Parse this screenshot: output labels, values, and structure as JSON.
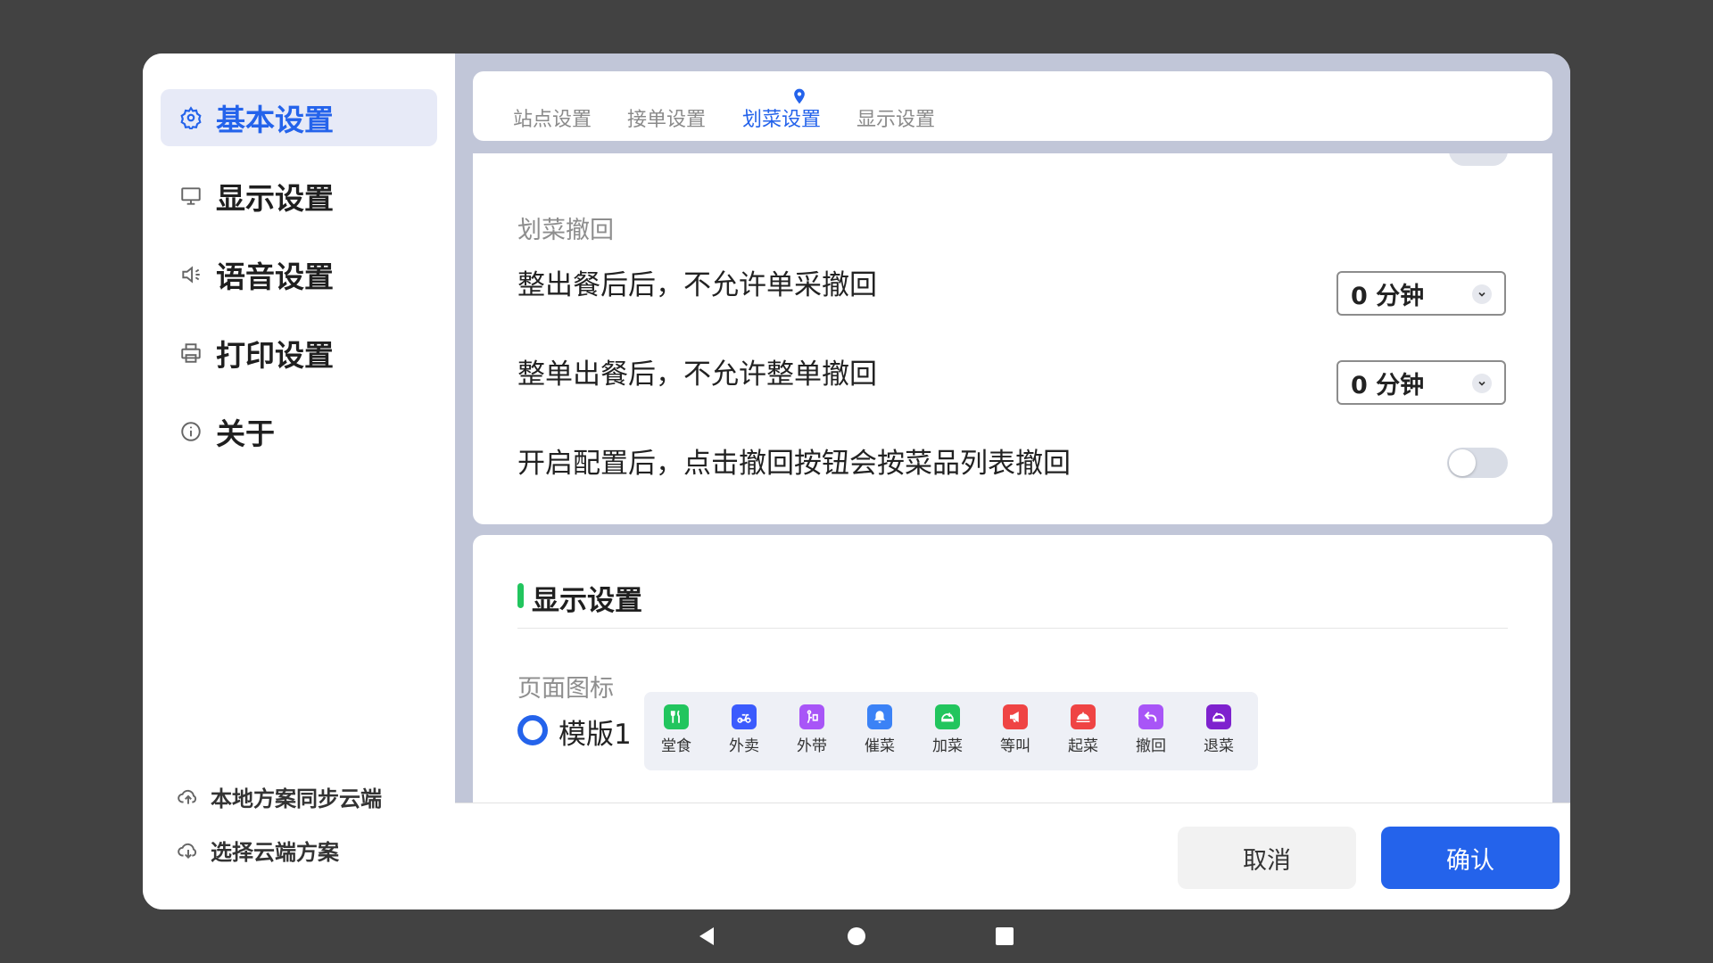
{
  "sidebar": {
    "items": [
      {
        "label": "基本设置",
        "icon": "gear-icon",
        "active": true
      },
      {
        "label": "显示设置",
        "icon": "monitor-icon",
        "active": false
      },
      {
        "label": "语音设置",
        "icon": "speaker-icon",
        "active": false
      },
      {
        "label": "打印设置",
        "icon": "printer-icon",
        "active": false
      },
      {
        "label": "关于",
        "icon": "info-icon",
        "active": false
      }
    ],
    "cloud_actions": [
      {
        "label": "本地方案同步云端",
        "icon": "cloud-upload-icon"
      },
      {
        "label": "选择云端方案",
        "icon": "cloud-download-icon"
      }
    ]
  },
  "tabs": [
    {
      "label": "站点设置",
      "active": false
    },
    {
      "label": "接单设置",
      "active": false
    },
    {
      "label": "划菜设置",
      "active": true
    },
    {
      "label": "显示设置",
      "active": false
    }
  ],
  "recall_section": {
    "subtitle": "划菜撤回",
    "rows": [
      {
        "label": "整出餐后后，不允许单采撤回",
        "value": "0 分钟"
      },
      {
        "label": "整单出餐后，不允许整单撤回",
        "value": "0 分钟"
      }
    ],
    "toggle_row": {
      "label": "开启配置后，点击撤回按钮会按菜品列表撤回",
      "on": false
    }
  },
  "display_section": {
    "title": "显示设置",
    "subtitle": "页面图标",
    "template_label": "模版1",
    "icons": [
      {
        "label": "堂食",
        "color": "#22c55e",
        "icon": "utensils-icon"
      },
      {
        "label": "外卖",
        "color": "#3b5bfd",
        "icon": "scooter-icon"
      },
      {
        "label": "外带",
        "color": "#a855f7",
        "icon": "takeaway-icon"
      },
      {
        "label": "催菜",
        "color": "#3b82f6",
        "icon": "bell-icon"
      },
      {
        "label": "加菜",
        "color": "#22c55e",
        "icon": "add-dish-icon"
      },
      {
        "label": "等叫",
        "color": "#ef4444",
        "icon": "megaphone-icon"
      },
      {
        "label": "起菜",
        "color": "#ef4444",
        "icon": "cloche-icon"
      },
      {
        "label": "撤回",
        "color": "#a855f7",
        "icon": "undo-icon"
      },
      {
        "label": "退菜",
        "color": "#7e22ce",
        "icon": "return-dish-icon"
      }
    ]
  },
  "footer": {
    "cancel_label": "取消",
    "ok_label": "确认"
  },
  "colors": {
    "accent": "#2463eb",
    "section_bar": "#22c55e",
    "main_bg": "#c1c6d8"
  }
}
